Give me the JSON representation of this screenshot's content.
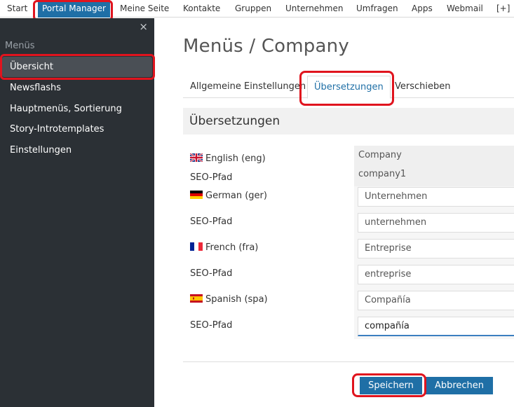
{
  "topnav": {
    "items": [
      "Start",
      "Portal Manager",
      "Meine Seite",
      "Kontakte",
      "Gruppen",
      "Unternehmen",
      "Umfragen",
      "Apps",
      "Webmail",
      "[+]"
    ],
    "active": "Portal Manager"
  },
  "sidebar": {
    "close_glyph": "×",
    "heading": "Menüs",
    "items": [
      {
        "label": "Übersicht",
        "active": true
      },
      {
        "label": "Newsflashs"
      },
      {
        "label": "Hauptmenüs, Sortierung"
      },
      {
        "label": "Story-Introtemplates"
      },
      {
        "label": "Einstellungen"
      }
    ]
  },
  "main": {
    "title": "Menüs / Company",
    "tabs": [
      "Allgemeine Einstellungen",
      "Übersetzungen",
      "Verschieben"
    ],
    "active_tab": "Übersetzungen",
    "section_title": "Übersetzungen",
    "rows": [
      {
        "lang": "English (eng)",
        "flag": "uk-flag",
        "value": "Company",
        "seo_label": "SEO-Pfad",
        "seo_value": "company1",
        "readonly": true
      },
      {
        "lang": "German (ger)",
        "flag": "germany-flag",
        "value": "Unternehmen",
        "seo_label": "SEO-Pfad",
        "seo_value": "unternehmen"
      },
      {
        "lang": "French (fra)",
        "flag": "france-flag",
        "value": "Entreprise",
        "seo_label": "SEO-Pfad",
        "seo_value": "entreprise"
      },
      {
        "lang": "Spanish (spa)",
        "flag": "spain-flag",
        "value": "Compañía",
        "seo_label": "SEO-Pfad",
        "seo_value": "compañía"
      }
    ],
    "buttons": {
      "save": "Speichern",
      "cancel": "Abbrechen"
    }
  },
  "colors": {
    "accent": "#1f6fa6",
    "sidebar_bg": "#2b3035",
    "highlight": "#e0141e"
  }
}
